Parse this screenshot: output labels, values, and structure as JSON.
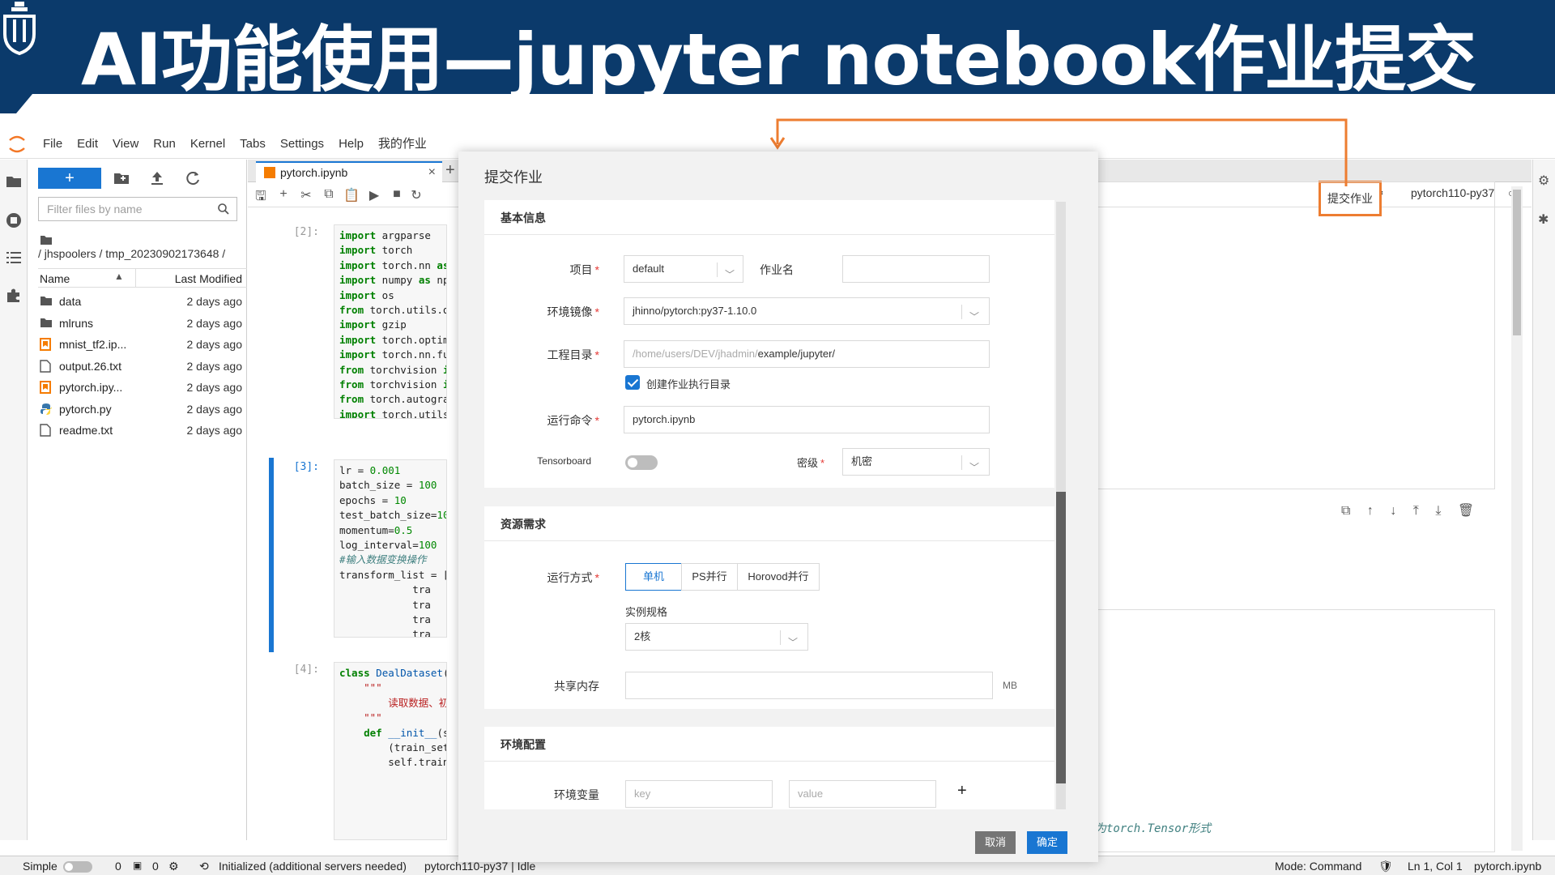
{
  "slide": {
    "title": "AI功能使用—jupyter notebook作业提交",
    "colors": {
      "banner": "#0b3a6b",
      "accent": "#ed7d31"
    }
  },
  "menubar": {
    "items": [
      "File",
      "Edit",
      "View",
      "Run",
      "Kernel",
      "Tabs",
      "Settings",
      "Help",
      "我的作业"
    ]
  },
  "filebrowser": {
    "new_label": "+",
    "filter_placeholder": "Filter files by name",
    "path": "/ jhspoolers / tmp_20230902173648 /",
    "col_name": "Name",
    "col_modified": "Last Modified",
    "files": [
      {
        "name": "data",
        "modified": "2 days ago",
        "icon": "folder-icon"
      },
      {
        "name": "mlruns",
        "modified": "2 days ago",
        "icon": "folder-icon"
      },
      {
        "name": "mnist_tf2.ip...",
        "modified": "2 days ago",
        "icon": "notebook-icon"
      },
      {
        "name": "output.26.txt",
        "modified": "2 days ago",
        "icon": "file-icon"
      },
      {
        "name": "pytorch.ipy...",
        "modified": "2 days ago",
        "icon": "notebook-icon"
      },
      {
        "name": "pytorch.py",
        "modified": "2 days ago",
        "icon": "python-icon"
      },
      {
        "name": "readme.txt",
        "modified": "2 days ago",
        "icon": "file-icon"
      }
    ]
  },
  "notebook": {
    "tab_label": "pytorch.ipynb",
    "submit_label": "提交作业",
    "kernel_name": "pytorch110-py37",
    "prompts": [
      "[2]:",
      "[3]:",
      "[4]:"
    ],
    "comment_tail": "为torch.Tensor形式"
  },
  "statusbar": {
    "mode_label": "Simple",
    "count1": "0",
    "count2": "0",
    "server_status": "Initialized (additional servers needed)",
    "kernel_status": "pytorch110-py37 | Idle",
    "mode": "Mode: Command",
    "cursor": "Ln 1, Col 1",
    "file": "pytorch.ipynb"
  },
  "dialog": {
    "title": "提交作业",
    "basic": {
      "title": "基本信息",
      "project_label": "项目",
      "project_value": "default",
      "jobname_label": "作业名",
      "jobname_value": "",
      "image_label": "环境镜像",
      "image_value": "jhinno/pytorch:py37-1.10.0",
      "workdir_label": "工程目录",
      "workdir_prefix": "/home/users/DEV/jhadmin/",
      "workdir_suffix": "example/jupyter/",
      "create_dir_label": "创建作业执行目录",
      "command_label": "运行命令",
      "command_value": "pytorch.ipynb",
      "tensorboard_label": "Tensorboard",
      "security_label": "密级",
      "security_value": "机密"
    },
    "resource": {
      "title": "资源需求",
      "runmode_label": "运行方式",
      "modes": [
        "单机",
        "PS并行",
        "Horovod并行"
      ],
      "spec_label": "实例规格",
      "spec_value": "2核",
      "shm_label": "共享内存",
      "shm_unit": "MB"
    },
    "env": {
      "title": "环境配置",
      "vars_label": "环境变量",
      "key_placeholder": "key",
      "value_placeholder": "value",
      "add_label": "+"
    },
    "cancel_label": "取消",
    "ok_label": "确定"
  }
}
